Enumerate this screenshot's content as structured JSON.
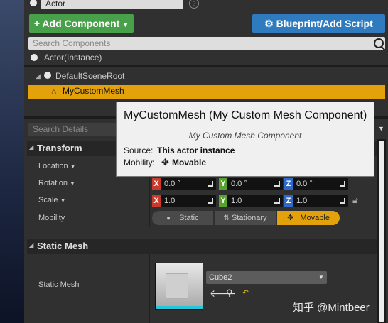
{
  "header": {
    "actor_name": "Actor",
    "add_component_label": "+ Add Component",
    "blueprint_label": "Blueprint/Add Script",
    "search_components_placeholder": "Search Components"
  },
  "components": {
    "instance_label": "Actor(Instance)",
    "root_label": "DefaultSceneRoot",
    "selected_label": "MyCustomMesh"
  },
  "details": {
    "search_placeholder": "Search Details",
    "transform_header": "Transform",
    "location_label": "Location",
    "rotation_label": "Rotation",
    "scale_label": "Scale",
    "mobility_label": "Mobility",
    "axis_x": "X",
    "axis_y": "Y",
    "axis_z": "Z",
    "rotation": {
      "x": "0.0 °",
      "y": "0.0 °",
      "z": "0.0 °"
    },
    "scale": {
      "x": "1.0",
      "y": "1.0",
      "z": "1.0"
    },
    "mobility_options": [
      "Static",
      "Stationary",
      "Movable"
    ],
    "mobility_selected": "Movable",
    "static_mesh_header": "Static Mesh",
    "static_mesh_label": "Static Mesh",
    "static_mesh_value": "Cube2"
  },
  "tooltip": {
    "title": "MyCustomMesh (My Custom Mesh Component)",
    "subtitle": "My Custom Mesh Component",
    "source_label": "Source:",
    "source_value": "This actor instance",
    "mobility_label": "Mobility:",
    "mobility_value": "Movable"
  },
  "watermark": "知乎 @Mintbeer",
  "colors": {
    "accent": "#e3a20b",
    "add_button": "#49a04a",
    "blueprint_button": "#2e7bbf",
    "axis_x": "#c83a2c",
    "axis_y": "#5aa02e",
    "axis_z": "#2e68c8"
  }
}
